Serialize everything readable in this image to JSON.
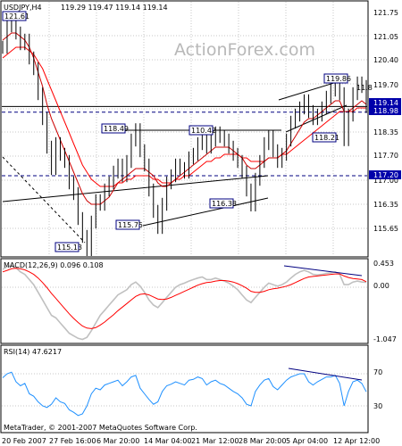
{
  "header": {
    "symbol_tf": "USDJPY,H4",
    "ohlc": "119.29 119.47 119.14 119.14"
  },
  "watermark": "ActionForex.com",
  "copyright": "MetaTrader, © 2001-2007 MetaQuotes Software Corp.",
  "colors": {
    "price_line": "#000000",
    "sma_fast": "#cc0000",
    "sma_slow": "#ff0000",
    "grid": "#c7c7c7",
    "trend": "#000080",
    "label_bg": "#ffffff",
    "label_border": "#000080",
    "price_box_bg": "#0000aa",
    "macd_main": "#c0c0c0",
    "macd_signal": "#ff0000",
    "rsi_line": "#1e90ff"
  },
  "chart_data": [
    {
      "type": "line",
      "title": "USDJPY,H4",
      "panel": "price",
      "ylim": [
        115.0,
        122.0
      ],
      "y_ticks": [
        "121.75",
        "121.05",
        "120.40",
        "119.70",
        "119.14",
        "118.98",
        "118.35",
        "117.70",
        "117.20",
        "117.00",
        "116.35",
        "115.65"
      ],
      "x_ticks": [
        "20 Feb 2007",
        "27 Feb 16:00",
        "6 Mar 20:00",
        "14 Mar 04:00",
        "21 Mar 12:00",
        "28 Mar 20:00",
        "5 Apr 04:00",
        "12 Apr 12:00"
      ],
      "series": [
        {
          "name": "close",
          "values": [
            120.8,
            121.4,
            121.61,
            121.2,
            120.9,
            121.0,
            120.5,
            120.2,
            119.5,
            118.8,
            118.0,
            117.4,
            118.1,
            117.8,
            117.6,
            117.0,
            116.7,
            116.0,
            115.5,
            115.13,
            115.9,
            116.5,
            116.4,
            116.8,
            117.0,
            117.3,
            117.5,
            117.2,
            117.6,
            118.2,
            118.49,
            117.9,
            117.5,
            116.8,
            116.2,
            115.75,
            116.4,
            117.0,
            117.2,
            117.5,
            117.4,
            117.3,
            117.7,
            117.8,
            118.1,
            118.3,
            118.0,
            118.2,
            118.4,
            118.3,
            118.2,
            118.0,
            117.8,
            117.6,
            117.3,
            116.8,
            116.38,
            117.1,
            117.6,
            118.1,
            118.3,
            117.9,
            117.6,
            117.8,
            118.2,
            118.7,
            118.9,
            119.1,
            119.3,
            119.0,
            118.8,
            118.9,
            119.1,
            119.4,
            119.6,
            119.86,
            119.5,
            118.21,
            118.9,
            119.5,
            119.8,
            119.7,
            119.14
          ]
        },
        {
          "name": "sma_fast",
          "values": [
            121.0,
            121.1,
            121.2,
            121.2,
            121.1,
            121.0,
            120.8,
            120.5,
            120.1,
            119.7,
            119.2,
            118.8,
            118.5,
            118.2,
            117.9,
            117.6,
            117.3,
            117.0,
            116.7,
            116.5,
            116.4,
            116.4,
            116.4,
            116.5,
            116.6,
            116.8,
            117.0,
            117.1,
            117.2,
            117.3,
            117.4,
            117.4,
            117.4,
            117.3,
            117.2,
            117.0,
            116.9,
            116.9,
            117.0,
            117.1,
            117.2,
            117.3,
            117.4,
            117.5,
            117.6,
            117.7,
            117.8,
            117.9,
            118.0,
            118.0,
            118.0,
            118.0,
            117.9,
            117.8,
            117.7,
            117.5,
            117.4,
            117.4,
            117.5,
            117.6,
            117.7,
            117.7,
            117.7,
            117.8,
            117.9,
            118.1,
            118.3,
            118.5,
            118.7,
            118.8,
            118.8,
            118.9,
            119.0,
            119.1,
            119.2,
            119.3,
            119.3,
            119.0,
            119.0,
            119.1,
            119.2,
            119.3,
            119.2
          ]
        },
        {
          "name": "sma_slow",
          "values": [
            120.5,
            120.6,
            120.7,
            120.8,
            120.8,
            120.8,
            120.7,
            120.6,
            120.4,
            120.2,
            119.9,
            119.6,
            119.3,
            119.0,
            118.7,
            118.4,
            118.1,
            117.8,
            117.5,
            117.3,
            117.1,
            117.0,
            116.9,
            116.9,
            116.9,
            116.9,
            117.0,
            117.0,
            117.1,
            117.1,
            117.2,
            117.2,
            117.2,
            117.2,
            117.1,
            117.1,
            117.0,
            117.0,
            117.0,
            117.1,
            117.1,
            117.2,
            117.2,
            117.3,
            117.4,
            117.5,
            117.6,
            117.6,
            117.7,
            117.7,
            117.8,
            117.8,
            117.8,
            117.8,
            117.7,
            117.7,
            117.6,
            117.6,
            117.6,
            117.6,
            117.7,
            117.7,
            117.7,
            117.8,
            117.8,
            117.9,
            118.0,
            118.1,
            118.2,
            118.3,
            118.4,
            118.5,
            118.6,
            118.7,
            118.8,
            118.9,
            119.0,
            119.0,
            119.0,
            119.0,
            119.1,
            119.1,
            119.1
          ]
        }
      ],
      "annotations": [
        "121.61",
        "118.49",
        "110.42",
        "119.86",
        "118.21",
        "116.38",
        "115.75",
        "115.13",
        "11.8"
      ],
      "horizontal_levels": [
        119.14,
        118.98,
        117.2
      ],
      "price_boxes": [
        "119.14",
        "118.98",
        "117.20"
      ]
    },
    {
      "type": "line",
      "title": "MACD(12,26,9) 0.096 0.108",
      "panel": "macd",
      "ylim": [
        -1.047,
        0.453
      ],
      "y_ticks": [
        "0.453",
        "0.00",
        "-1.047"
      ],
      "series": [
        {
          "name": "main",
          "values": [
            0.35,
            0.4,
            0.42,
            0.38,
            0.3,
            0.25,
            0.15,
            0.05,
            -0.1,
            -0.25,
            -0.4,
            -0.55,
            -0.6,
            -0.7,
            -0.8,
            -0.9,
            -0.95,
            -1.0,
            -1.02,
            -0.98,
            -0.85,
            -0.7,
            -0.55,
            -0.45,
            -0.35,
            -0.25,
            -0.15,
            -0.1,
            -0.05,
            0.05,
            0.1,
            0.02,
            -0.1,
            -0.25,
            -0.35,
            -0.4,
            -0.3,
            -0.2,
            -0.1,
            0.0,
            0.05,
            0.08,
            0.12,
            0.15,
            0.18,
            0.2,
            0.15,
            0.15,
            0.18,
            0.15,
            0.12,
            0.08,
            0.02,
            -0.05,
            -0.15,
            -0.25,
            -0.3,
            -0.2,
            -0.1,
            0.0,
            0.08,
            0.05,
            0.02,
            0.05,
            0.1,
            0.18,
            0.25,
            0.3,
            0.33,
            0.3,
            0.25,
            0.24,
            0.25,
            0.27,
            0.28,
            0.3,
            0.25,
            0.05,
            0.05,
            0.1,
            0.12,
            0.1,
            0.096
          ]
        },
        {
          "name": "signal",
          "values": [
            0.3,
            0.33,
            0.36,
            0.37,
            0.36,
            0.34,
            0.3,
            0.25,
            0.18,
            0.09,
            -0.01,
            -0.12,
            -0.22,
            -0.32,
            -0.42,
            -0.52,
            -0.61,
            -0.69,
            -0.76,
            -0.8,
            -0.81,
            -0.79,
            -0.74,
            -0.68,
            -0.61,
            -0.54,
            -0.46,
            -0.39,
            -0.32,
            -0.25,
            -0.18,
            -0.14,
            -0.13,
            -0.15,
            -0.19,
            -0.23,
            -0.24,
            -0.23,
            -0.2,
            -0.16,
            -0.12,
            -0.08,
            -0.04,
            0.0,
            0.04,
            0.07,
            0.09,
            0.1,
            0.12,
            0.13,
            0.13,
            0.12,
            0.1,
            0.07,
            0.03,
            -0.02,
            -0.08,
            -0.1,
            -0.1,
            -0.08,
            -0.05,
            -0.03,
            -0.02,
            0.0,
            0.02,
            0.05,
            0.09,
            0.13,
            0.17,
            0.2,
            0.21,
            0.22,
            0.23,
            0.24,
            0.25,
            0.26,
            0.26,
            0.22,
            0.19,
            0.17,
            0.16,
            0.15,
            0.108
          ]
        }
      ]
    },
    {
      "type": "line",
      "title": "RSI(14) 47.6217",
      "panel": "rsi",
      "ylim": [
        0,
        100
      ],
      "y_ticks": [
        "70",
        "30"
      ],
      "series": [
        {
          "name": "rsi",
          "values": [
            65,
            70,
            72,
            60,
            55,
            58,
            45,
            42,
            35,
            30,
            28,
            32,
            40,
            35,
            33,
            25,
            22,
            18,
            20,
            30,
            45,
            52,
            50,
            56,
            58,
            60,
            62,
            55,
            60,
            66,
            68,
            52,
            45,
            38,
            32,
            35,
            48,
            55,
            57,
            60,
            58,
            56,
            62,
            63,
            66,
            64,
            56,
            60,
            62,
            58,
            56,
            52,
            48,
            45,
            40,
            32,
            30,
            48,
            56,
            62,
            64,
            54,
            50,
            56,
            62,
            66,
            68,
            70,
            70,
            60,
            56,
            60,
            63,
            66,
            66,
            68,
            58,
            30,
            48,
            60,
            62,
            58,
            47.6
          ]
        }
      ]
    }
  ]
}
